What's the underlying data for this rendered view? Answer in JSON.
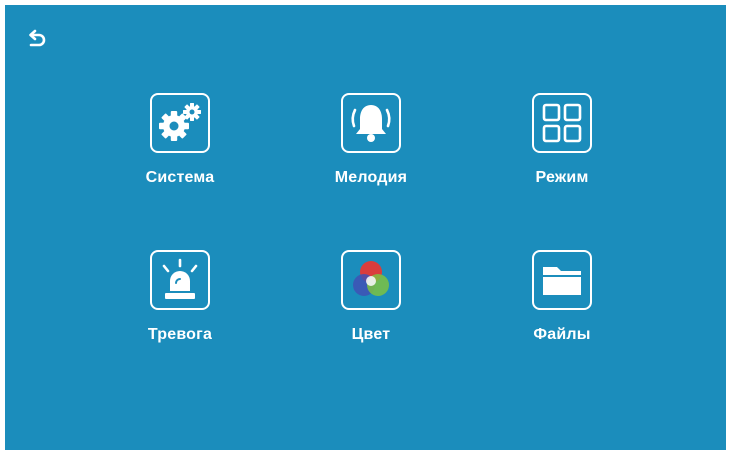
{
  "colors": {
    "background": "#1b8dbc",
    "foreground": "#ffffff"
  },
  "toolbar": {
    "back_icon": "back-arrow-icon"
  },
  "menu": {
    "items": [
      {
        "label": "Система",
        "icon": "gears-icon"
      },
      {
        "label": "Мелодия",
        "icon": "bell-icon"
      },
      {
        "label": "Режим",
        "icon": "grid-icon"
      },
      {
        "label": "Тревога",
        "icon": "alarm-light-icon"
      },
      {
        "label": "Цвет",
        "icon": "color-circles-icon"
      },
      {
        "label": "Файлы",
        "icon": "folder-icon"
      }
    ]
  }
}
